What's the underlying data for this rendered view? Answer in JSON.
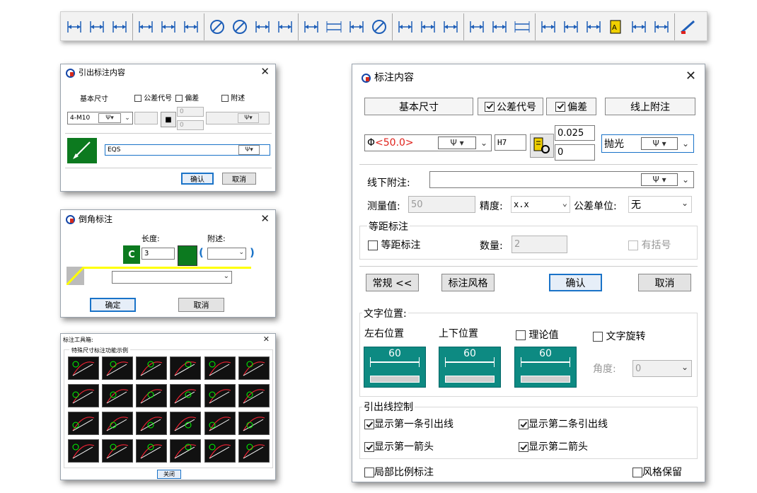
{
  "toolbar": {
    "icons": [
      "linear-dim-icon",
      "aligned-dim-icon",
      "horizontal-dim-icon",
      "vertical-dim-icon",
      "angled-dim-icon",
      "coordinate-dim-icon",
      "diameter-dim-icon",
      "radius-dim-icon",
      "arc-dim-icon",
      "chord-dim-icon",
      "arc-length-icon",
      "continuous-dim-icon",
      "baseline-dim-icon",
      "center-mark-icon",
      "angle-dim-icon",
      "leader-icon",
      "datum-icon",
      "surface-finish-icon",
      "tolerance-frame-icon",
      "equal-spacing-icon",
      "chamfer-dim-icon",
      "weld-symbol-icon",
      "section-symbol-icon",
      "text-icon",
      "zigzag-icon",
      "break-icon",
      "edit-dim-icon"
    ]
  },
  "lead_dialog": {
    "title": "引出标注内容",
    "basic_size": "基本尺寸",
    "tol_code": "公差代号",
    "deviation": "偏差",
    "note": "附述",
    "value": "4-M10",
    "psi": "Ψ",
    "upper": "0",
    "lower": "0",
    "text": "EQS",
    "ok": "确认",
    "cancel": "取消"
  },
  "chamfer_dialog": {
    "title": "倒角标注",
    "length_label": "长度:",
    "note_label": "附述:",
    "c_symbol": "C",
    "length": "3",
    "paren_open": "(",
    "paren_close": ")",
    "ok": "确定",
    "cancel": "取消"
  },
  "toolbox": {
    "title": "标注工具箱:",
    "group": "特殊尺寸标注功能示例",
    "close": "关闭"
  },
  "main_dialog": {
    "title": "标注内容",
    "basic_size": "基本尺寸",
    "tol_code": "公差代号",
    "deviation": "偏差",
    "above_note": "线上附注",
    "phi": "Φ",
    "value": "<50.0>",
    "psi": "Ψ",
    "fit_code": "H7",
    "upper": "0.025",
    "lower": "0",
    "finish": "抛光",
    "below_note": "线下附注:",
    "measured_label": "测量值:",
    "measured": "50",
    "precision_label": "精度:",
    "precision": "x.x",
    "tol_unit_label": "公差单位:",
    "tol_unit": "无",
    "equal_group": "等距标注",
    "equal_label": "等距标注",
    "count_label": "数量:",
    "count": "2",
    "bracket_label": "有括号",
    "normal_btn": "常规 <<",
    "style_btn": "标注风格",
    "ok": "确认",
    "cancel": "取消",
    "text_pos": "文字位置:",
    "lr_pos": "左右位置",
    "ud_pos": "上下位置",
    "theory": "理论值",
    "rotate": "文字旋转",
    "preview_value": "60",
    "angle_label": "角度:",
    "angle": "0",
    "leader_group": "引出线控制",
    "show_l1": "显示第一条引出线",
    "show_l2": "显示第二条引出线",
    "show_a1": "显示第一箭头",
    "show_a2": "显示第二箭头",
    "local_scale": "局部比例标注",
    "keep_style": "风格保留"
  },
  "colors": {
    "value_red": "#e0211b",
    "accent_blue": "#1a73c8",
    "preview_teal": "#0d8a82",
    "green": "#0c7a1f"
  }
}
